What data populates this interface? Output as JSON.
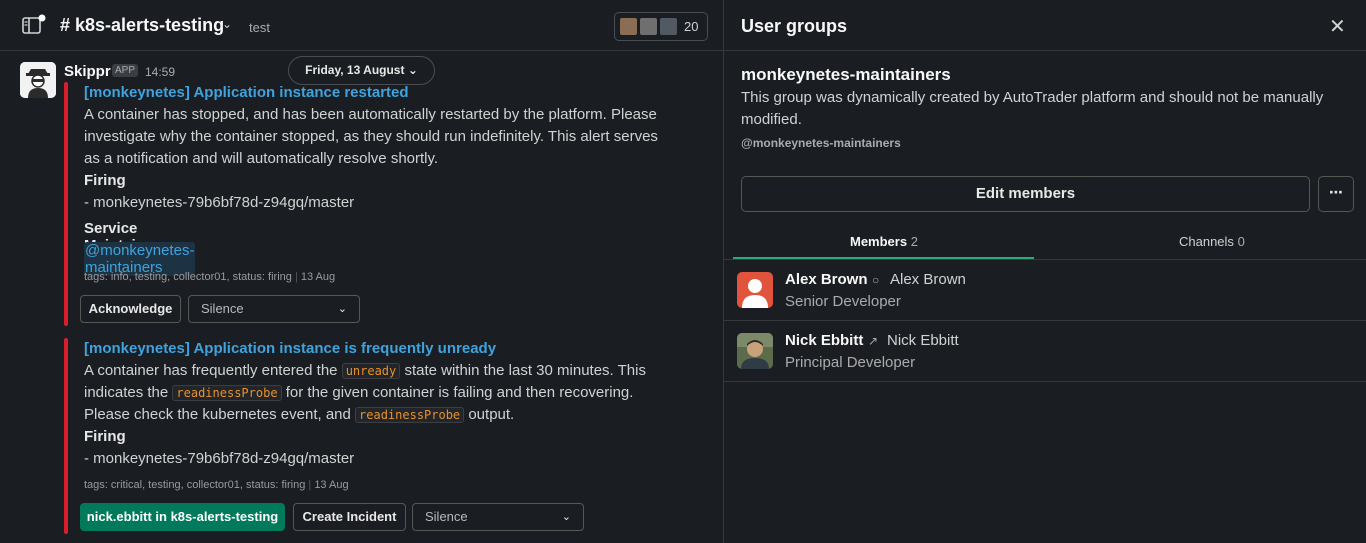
{
  "channel": {
    "name": "# k8s-alerts-testing",
    "topic": "test",
    "member_count": "20",
    "date_divider": "Friday, 13 August"
  },
  "message": {
    "sender": "Skippr",
    "badge": "APP",
    "time": "14:59"
  },
  "alerts": [
    {
      "title": "[monkeynetes] Application instance restarted",
      "body": "A container has stopped, and has been automatically restarted by the platform. Please investigate why the container stopped, as they should run indefinitely. This alert serves as a notification and will automatically resolve shortly.",
      "status_label": "Firing",
      "instance": "- monkeynetes-79b6bf78d-z94gq/master",
      "maintainers_label": "Service Maintainers",
      "maintainers_mention": "@monkeynetes-maintainers",
      "footer_tags": "tags: info, testing, collector01, status: firing",
      "footer_date": "13 Aug",
      "button_acknowledge": "Acknowledge",
      "select_silence": "Silence"
    },
    {
      "title": "[monkeynetes] Application instance is frequently unready",
      "body_part1": "A container has frequently entered the",
      "code1": "unready",
      "body_part2": "state within the last 30 minutes. This indicates the",
      "code2": "readinessProbe",
      "body_part3": "for the given container is failing and then recovering. Please check the kubernetes event, and",
      "code3": "readinessProbe",
      "body_part4": "output.",
      "status_label": "Firing",
      "instance": "- monkeynetes-79b6bf78d-z94gq/master",
      "footer_tags": "tags: critical, testing, collector01, status: firing",
      "footer_date": "13 Aug",
      "button_claimed": "nick.ebbitt in k8s-alerts-testing",
      "button_create_incident": "Create Incident",
      "select_silence": "Silence"
    }
  ],
  "user_groups": {
    "header": "User groups",
    "group_name": "monkeynetes-maintainers",
    "description": "This group was dynamically created by AutoTrader platform and should not be manually modified.",
    "handle": "@monkeynetes-maintainers",
    "edit_button": "Edit members",
    "more_button": "⋯",
    "tabs": [
      {
        "label": "Members",
        "count": "2"
      },
      {
        "label": "Channels",
        "count": "0"
      }
    ],
    "members": [
      {
        "name": "Alex Brown",
        "display_name": "Alex Brown",
        "title": "Senior Developer",
        "status_icon": "presence-circle-icon"
      },
      {
        "name": "Nick Ebbitt",
        "display_name": "Nick Ebbitt",
        "title": "Principal Developer",
        "status_icon": "link-icon"
      }
    ]
  },
  "colors": {
    "background": "#1a1d21",
    "link": "#3ea3de",
    "alert_bar": "#d81e2b",
    "primary_button": "#007a5a",
    "tab_underline": "#2bac76",
    "code_text": "#e8912d"
  }
}
